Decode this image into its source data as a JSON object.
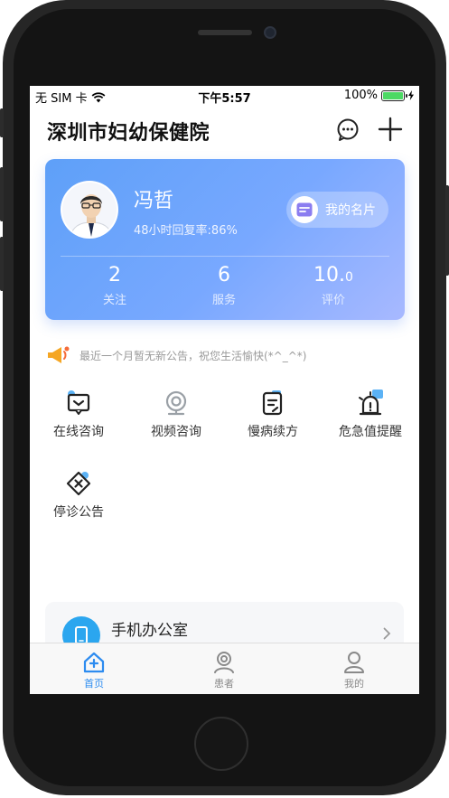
{
  "status_bar": {
    "carrier": "无 SIM 卡",
    "time": "下午5:57",
    "battery_text": "100%",
    "battery_level": 1.0
  },
  "nav": {
    "title": "深圳市妇幼保健院",
    "message_icon": "chat-bubble-icon",
    "add_icon": "plus-icon"
  },
  "profile": {
    "name": "冯哲",
    "reply_rate": "48小时回复率:86%",
    "card_button_label": "我的名片",
    "stats": [
      {
        "value": "2",
        "label": "关注"
      },
      {
        "value": "6",
        "label": "服务"
      },
      {
        "value": "10.",
        "value_small": "0",
        "label": "评价"
      }
    ]
  },
  "notice": {
    "text": "最近一个月暂无新公告，祝您生活愉快(*^_^*)"
  },
  "features": [
    {
      "label": "在线咨询",
      "icon": "message-box-icon"
    },
    {
      "label": "视频咨询",
      "icon": "webcam-icon"
    },
    {
      "label": "慢病续方",
      "icon": "prescription-icon"
    },
    {
      "label": "危急值提醒",
      "icon": "alarm-light-icon"
    },
    {
      "label": "停诊公告",
      "icon": "suspend-notice-icon"
    }
  ],
  "office": {
    "title": "手机办公室"
  },
  "tabs": [
    {
      "label": "首页",
      "icon": "home-icon",
      "active": true
    },
    {
      "label": "患者",
      "icon": "patient-icon",
      "active": false
    },
    {
      "label": "我的",
      "icon": "profile-icon",
      "active": false
    }
  ],
  "colors": {
    "accent": "#2d8cf0",
    "card_gradient_start": "#5ea0f8",
    "card_gradient_end": "#a8b9ff",
    "tab_inactive": "#8a8a8a",
    "battery": "#4cd964"
  }
}
